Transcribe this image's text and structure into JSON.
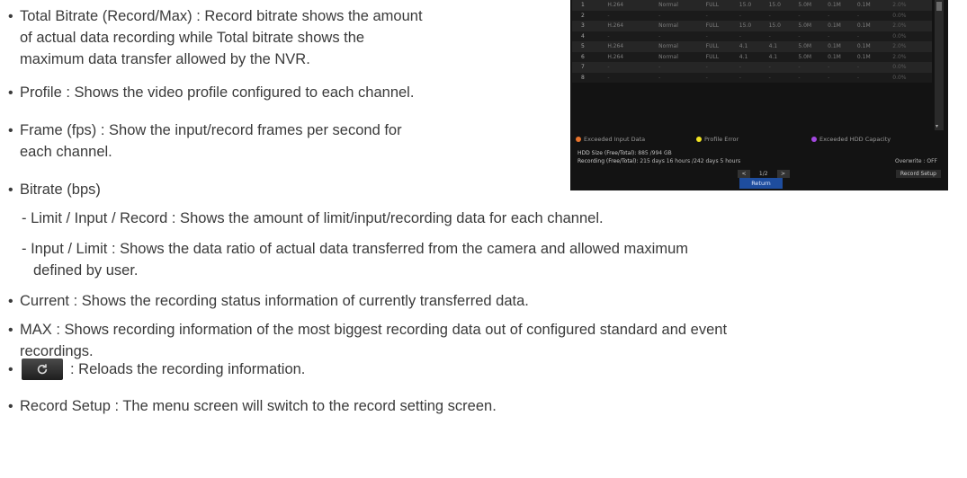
{
  "bullets": {
    "total_bitrate": [
      "Total Bitrate (Record/Max) : Record bitrate shows the amount",
      "of actual data recording while Total bitrate shows the",
      "maximum data transfer allowed by the NVR."
    ],
    "profile": "Profile : Shows the video profile configured to each channel.",
    "frame": [
      "Frame (fps) : Show the input/record frames per second for",
      "each channel."
    ],
    "bitrate": "Bitrate (bps)",
    "bitrate_sub1": "- Limit / Input / Record : Shows the amount of limit/input/recording data for each channel.",
    "bitrate_sub2": [
      "- Input / Limit : Shows the data ratio of actual data transferred from the camera and allowed maximum",
      "defined by user."
    ],
    "current": "Current : Shows the recording status information of currently transferred data.",
    "max": [
      "MAX : Shows recording information of the most biggest recording data out of configured standard and event",
      "recordings."
    ],
    "reload": ": Reloads the recording information.",
    "record_setup": "Record Setup : The menu screen will switch to the record setting screen.",
    "bullet_char": "•"
  },
  "icons": {
    "reload": "refresh-icon"
  },
  "nvr": {
    "rows": [
      [
        "1",
        "H.264",
        "Normal",
        "FULL",
        "15.0",
        "15.0",
        "5.0M",
        "0.1M",
        "0.1M",
        "2.0%"
      ],
      [
        "2",
        "-",
        "-",
        "-",
        "-",
        "-",
        "-",
        "-",
        "-",
        "0.0%"
      ],
      [
        "3",
        "H.264",
        "Normal",
        "FULL",
        "15.0",
        "15.0",
        "5.0M",
        "0.1M",
        "0.1M",
        "2.0%"
      ],
      [
        "4",
        "-",
        "-",
        "-",
        "-",
        "-",
        "-",
        "-",
        "-",
        "0.0%"
      ],
      [
        "5",
        "H.264",
        "Normal",
        "FULL",
        "4.1",
        "4.1",
        "5.0M",
        "0.1M",
        "0.1M",
        "2.0%"
      ],
      [
        "6",
        "H.264",
        "Normal",
        "FULL",
        "4.1",
        "4.1",
        "5.0M",
        "0.1M",
        "0.1M",
        "2.0%"
      ],
      [
        "7",
        "-",
        "-",
        "-",
        "-",
        "-",
        "-",
        "-",
        "-",
        "0.0%"
      ],
      [
        "8",
        "-",
        "-",
        "-",
        "-",
        "-",
        "-",
        "-",
        "-",
        "0.0%"
      ]
    ],
    "legend": [
      "Exceeded Input Data",
      "Profile Error",
      "Exceeded HDD Capacity"
    ],
    "legend_colors": [
      "#e8732c",
      "#f2e422",
      "#a348e0"
    ],
    "hdd_label": "HDD Size  (Free/Total):",
    "hdd_value": "885 /994 GB",
    "rec_label": "Recording  (Free/Total):",
    "rec_value": "215 days 16 hours  /242 days 5 hours",
    "overwrite": "Overwrite :  OFF",
    "page": "1/2",
    "prev": "<",
    "next": ">",
    "record_setup_btn": "Record Setup",
    "return_btn": "Return"
  }
}
